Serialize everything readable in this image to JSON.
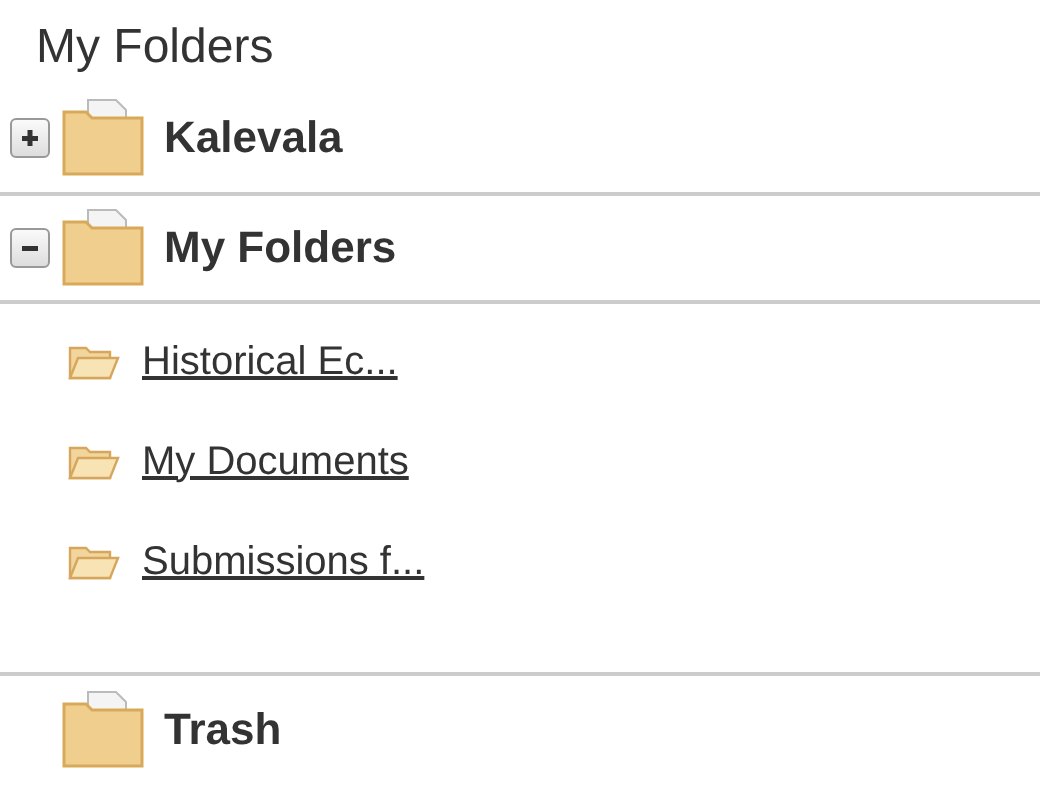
{
  "panel": {
    "title": "My Folders"
  },
  "folders": [
    {
      "label": "Kalevala",
      "expanded": false
    },
    {
      "label": "My Folders",
      "expanded": true,
      "children": [
        {
          "label": "Historical Ec..."
        },
        {
          "label": "My Documents"
        },
        {
          "label": "Submissions f..."
        }
      ]
    },
    {
      "label": "Trash"
    }
  ]
}
